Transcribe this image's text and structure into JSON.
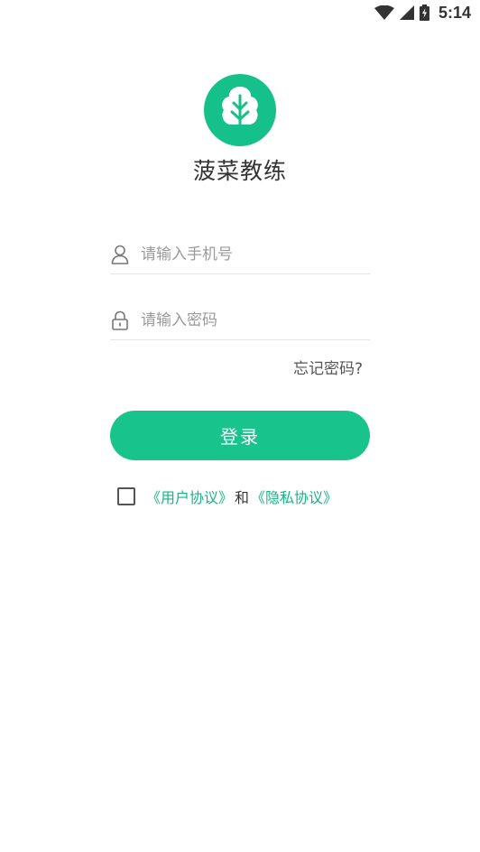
{
  "status_bar": {
    "time": "5:14",
    "icons": [
      "wifi-icon",
      "signal-icon",
      "battery-charging-icon"
    ]
  },
  "app": {
    "name": "菠菜教练",
    "logo_icon": "leaf-icon",
    "accent_color": "#19c38c"
  },
  "login_form": {
    "phone": {
      "placeholder": "请输入手机号",
      "value": "",
      "icon": "user-icon"
    },
    "password": {
      "placeholder": "请输入密码",
      "value": "",
      "icon": "lock-icon"
    },
    "forgot_password_label": "忘记密码?",
    "submit_label": "登录"
  },
  "agreement": {
    "checked": false,
    "user_agreement_label": "《用户协议》",
    "conjunction": "和",
    "privacy_policy_label": "《隐私协议》"
  }
}
